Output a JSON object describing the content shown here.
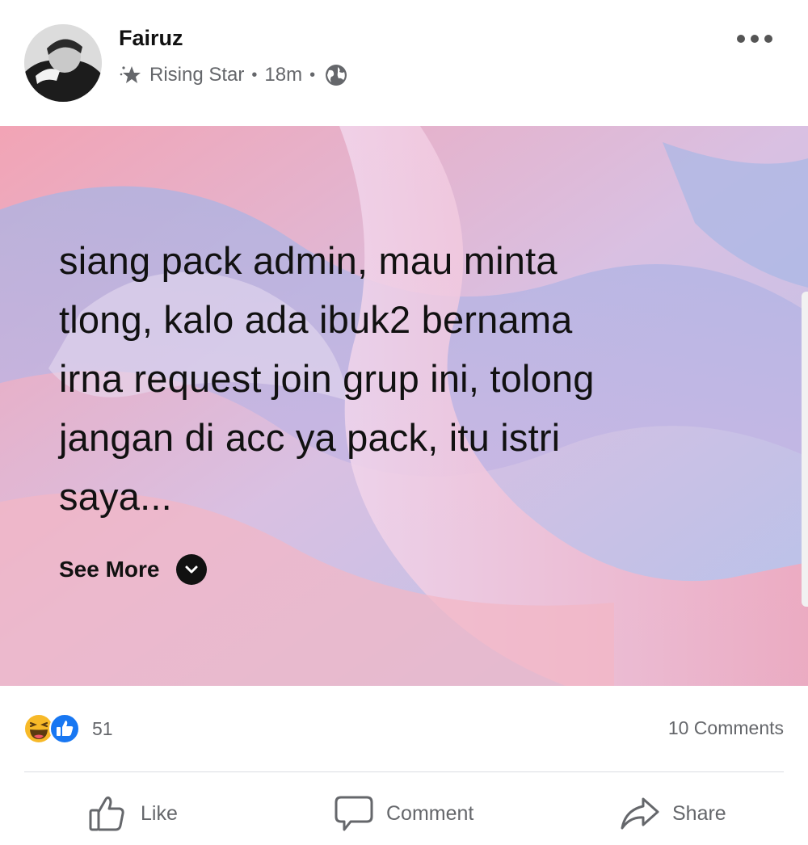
{
  "post": {
    "author": "Fairuz",
    "badge": "Rising Star",
    "time": "18m",
    "separator": "•",
    "audience_icon": "globe-icon",
    "text_lines": [
      "siang pack admin, mau minta",
      "tlong, kalo ada ibuk2 bernama",
      "irna request join grup ini, tolong",
      "jangan di acc ya pack, itu istri",
      "saya..."
    ],
    "see_more": "See More"
  },
  "stats": {
    "reaction_icons": [
      "haha-icon",
      "like-reaction-icon"
    ],
    "reaction_count": "51",
    "comments": "10 Comments"
  },
  "actions": {
    "like": "Like",
    "comment": "Comment",
    "share": "Share"
  },
  "colors": {
    "muted_text": "#65676b",
    "like_blue": "#1877f2",
    "haha_yellow": "#f7b928"
  }
}
